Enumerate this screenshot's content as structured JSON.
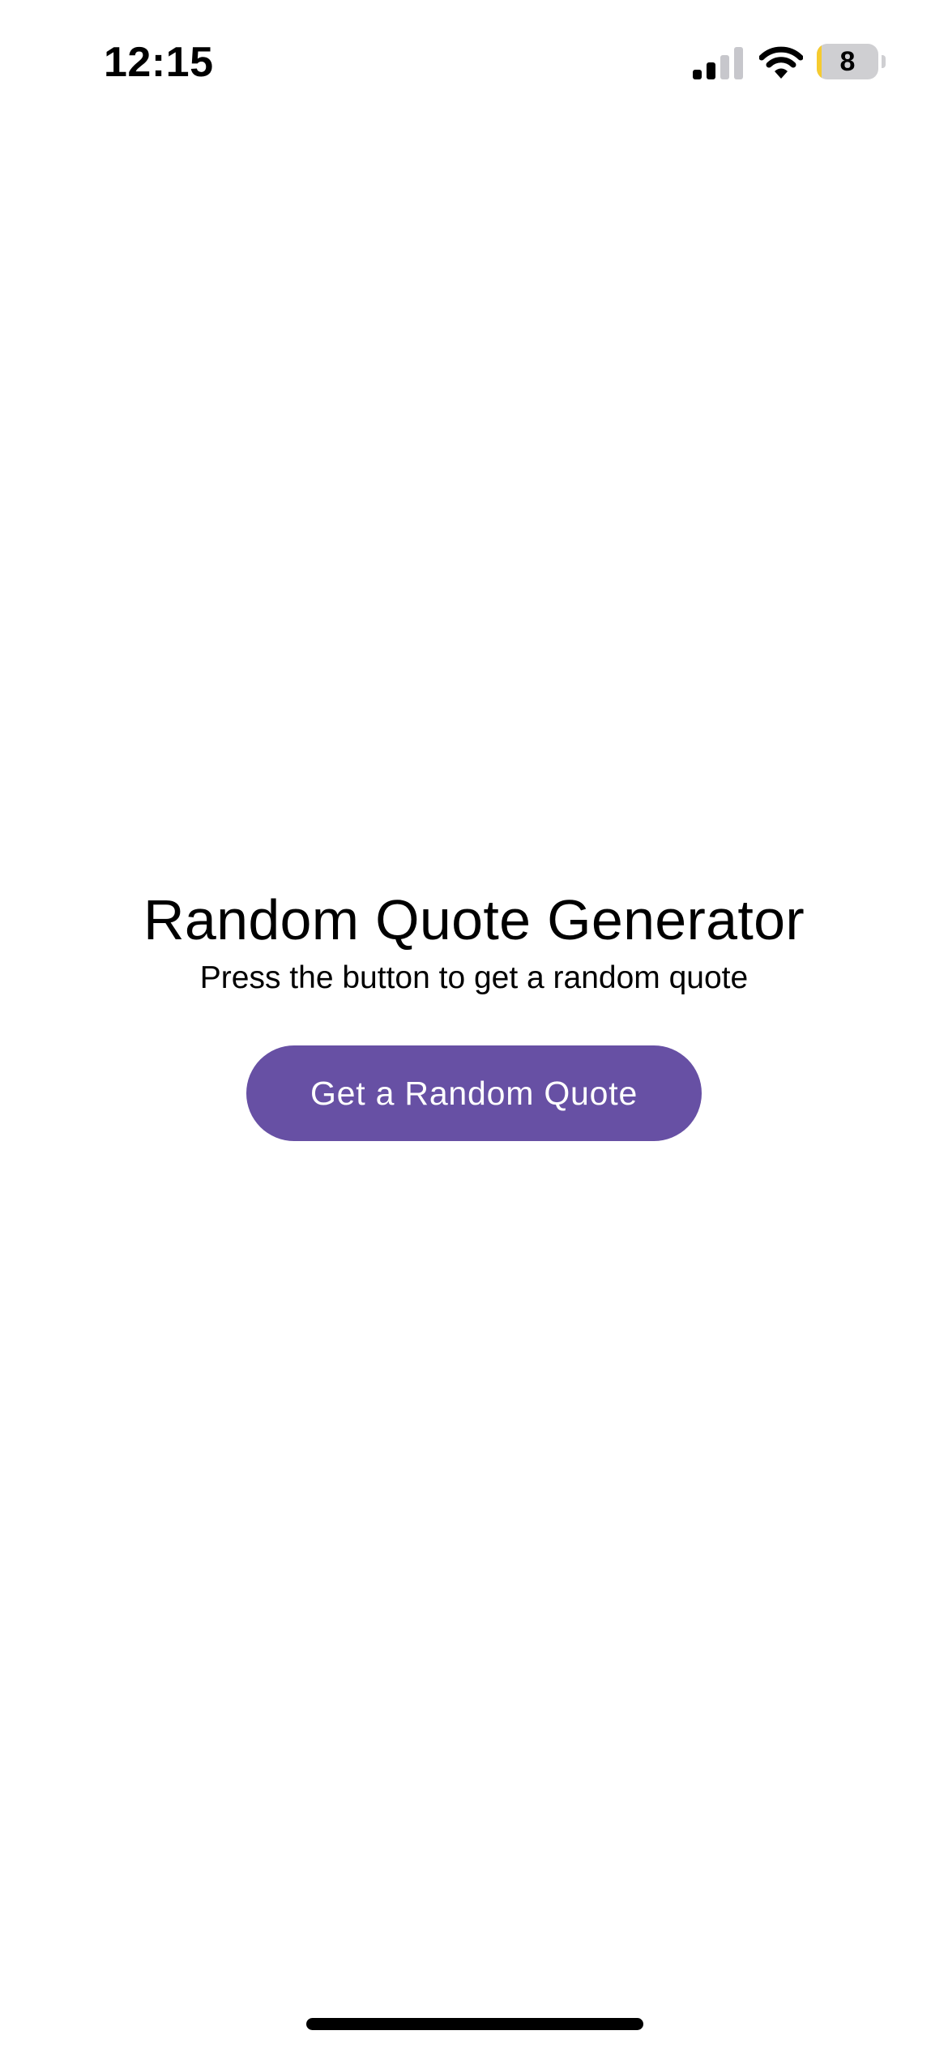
{
  "status_bar": {
    "time": "12:15",
    "signal_icon": "cellular-signal-icon",
    "signal_bars_active": 2,
    "signal_bars_total": 4,
    "wifi_icon": "wifi-icon",
    "battery_icon": "battery-icon",
    "battery_level": "8",
    "battery_fraction": 0.08,
    "battery_color": "#f6cb2f"
  },
  "main": {
    "title": "Random Quote Generator",
    "subtitle": "Press the button to get a random quote",
    "button_label": "Get a Random Quote",
    "button_color": "#6750a4"
  }
}
